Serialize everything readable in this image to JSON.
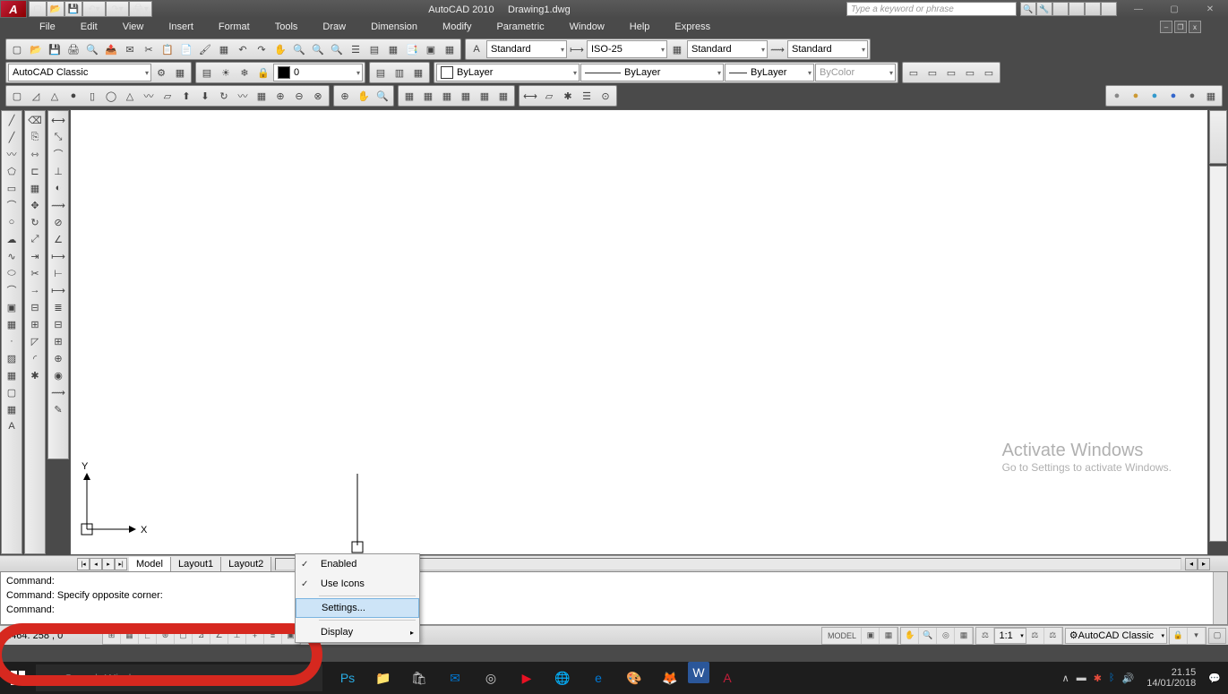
{
  "title": {
    "app": "AutoCAD 2010",
    "file": "Drawing1.dwg"
  },
  "search": {
    "placeholder": "Type a keyword or phrase"
  },
  "menus": [
    "File",
    "Edit",
    "View",
    "Insert",
    "Format",
    "Tools",
    "Draw",
    "Dimension",
    "Modify",
    "Parametric",
    "Window",
    "Help",
    "Express"
  ],
  "workspace_dd": "AutoCAD Classic",
  "layer_dd": "0",
  "props": {
    "bylayer1": "ByLayer",
    "bylayer2": "ByLayer",
    "bylayer3": "ByLayer",
    "bycolor": "ByColor"
  },
  "styles": {
    "text": "Standard",
    "dim": "ISO-25",
    "table": "Standard",
    "ml": "Standard"
  },
  "layout_tabs": [
    "Model",
    "Layout1",
    "Layout2"
  ],
  "cmd": {
    "l1": "Command:",
    "l2": "Command: Specify opposite corner:",
    "l3": "Command:"
  },
  "context": {
    "enabled": "Enabled",
    "useicons": "Use Icons",
    "settings": "Settings...",
    "display": "Display"
  },
  "status": {
    "coords": "1464. 258 , 0",
    "model": "MODEL",
    "scale": "1:1",
    "ws": "AutoCAD Classic"
  },
  "watermark": {
    "t1": "Activate Windows",
    "t2": "Go to Settings to activate Windows."
  },
  "taskbar": {
    "search": "Search Windows",
    "time": "21.15",
    "date": "14/01/2018"
  },
  "ucs": {
    "x": "X",
    "y": "Y"
  },
  "annot_icon": "A"
}
